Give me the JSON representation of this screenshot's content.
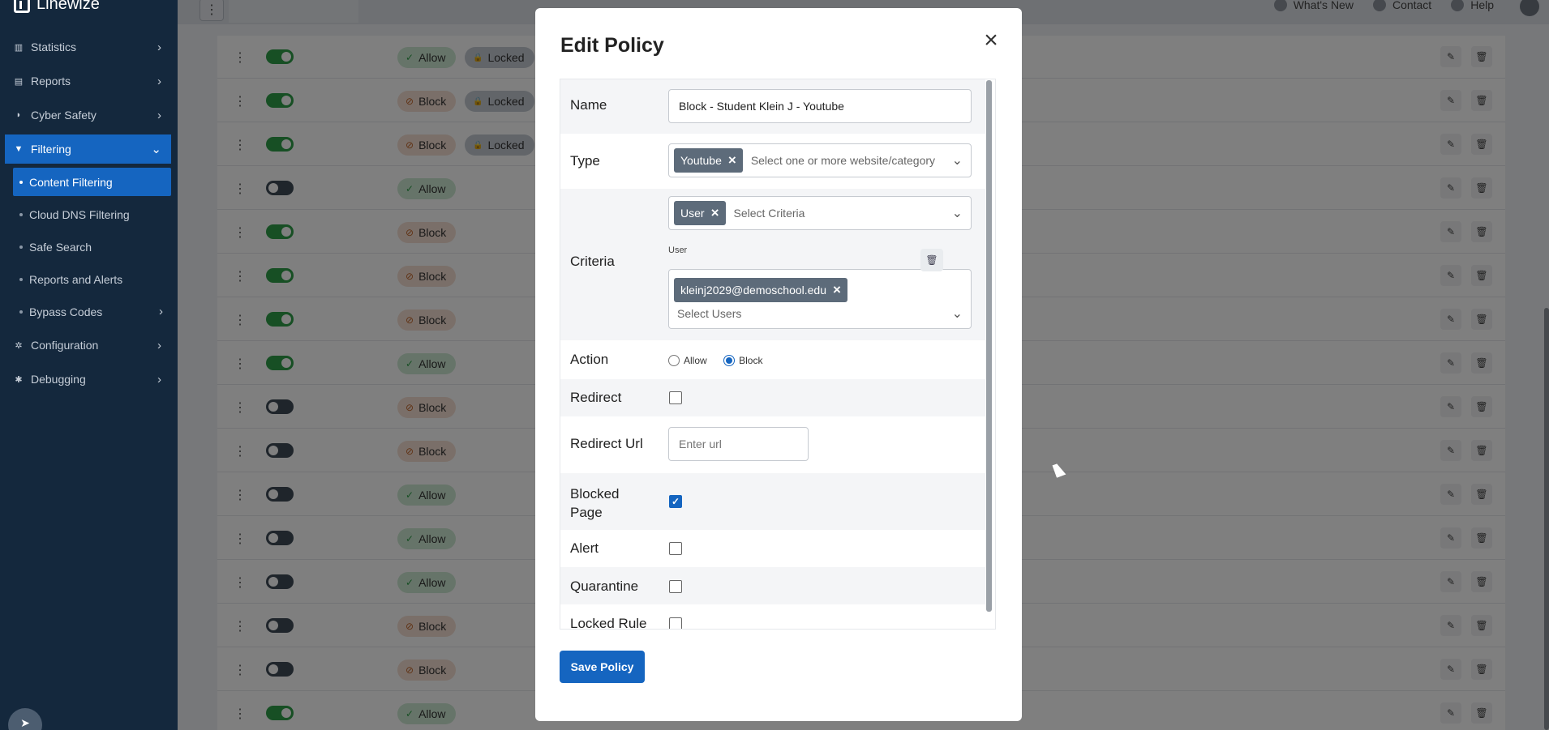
{
  "app": {
    "brand": "Linewize"
  },
  "topbar": {
    "links": [
      "What's New",
      "Contact",
      "Help"
    ]
  },
  "sidebar": {
    "items": [
      {
        "label": "Statistics",
        "icon": "chart-icon"
      },
      {
        "label": "Reports",
        "icon": "report-icon"
      },
      {
        "label": "Cyber Safety",
        "icon": "shield-icon"
      },
      {
        "label": "Filtering",
        "icon": "filter-icon",
        "active": true
      },
      {
        "label": "Configuration",
        "icon": "gear-icon"
      },
      {
        "label": "Debugging",
        "icon": "bug-icon"
      }
    ],
    "sub_items": [
      {
        "label": "Content Filtering",
        "active": true
      },
      {
        "label": "Cloud DNS Filtering"
      },
      {
        "label": "Safe Search"
      },
      {
        "label": "Reports and Alerts"
      },
      {
        "label": "Bypass Codes"
      }
    ]
  },
  "table": {
    "locked_label": "Locked",
    "rows": [
      {
        "enabled": true,
        "action": "Allow",
        "locked": true
      },
      {
        "enabled": true,
        "action": "Block",
        "locked": true
      },
      {
        "enabled": true,
        "action": "Block",
        "locked": true
      },
      {
        "enabled": false,
        "action": "Allow",
        "locked": false
      },
      {
        "enabled": true,
        "action": "Block",
        "locked": false
      },
      {
        "enabled": true,
        "action": "Block",
        "locked": false
      },
      {
        "enabled": true,
        "action": "Block",
        "locked": false
      },
      {
        "enabled": true,
        "action": "Allow",
        "locked": false
      },
      {
        "enabled": false,
        "action": "Block",
        "locked": false
      },
      {
        "enabled": false,
        "action": "Block",
        "locked": false
      },
      {
        "enabled": false,
        "action": "Allow",
        "locked": false
      },
      {
        "enabled": false,
        "action": "Allow",
        "locked": false
      },
      {
        "enabled": false,
        "action": "Allow",
        "locked": false
      },
      {
        "enabled": false,
        "action": "Block",
        "locked": false
      },
      {
        "enabled": false,
        "action": "Block",
        "locked": false
      },
      {
        "enabled": true,
        "action": "Allow",
        "locked": false
      }
    ]
  },
  "modal": {
    "title": "Edit Policy",
    "name_label": "Name",
    "name_value": "Block - Student Klein J - Youtube",
    "type_label": "Type",
    "type_chip": "Youtube",
    "type_placeholder": "Select one or more website/category",
    "criteria_label": "Criteria",
    "criteria_chip": "User",
    "criteria_placeholder": "Select Criteria",
    "criteria_sub_label": "User",
    "user_chip": "kleinj2029@demoschool.edu",
    "users_placeholder": "Select Users",
    "action_label": "Action",
    "action_options": [
      "Allow",
      "Block"
    ],
    "action_selected": "Block",
    "redirect_label": "Redirect",
    "redirect_checked": false,
    "redirect_url_label": "Redirect Url",
    "redirect_url_placeholder": "Enter url",
    "blocked_page_label_1": "Blocked",
    "blocked_page_label_2": "Page",
    "blocked_page_checked": true,
    "alert_label": "Alert",
    "alert_checked": false,
    "quarantine_label": "Quarantine",
    "quarantine_checked": false,
    "locked_rule_label": "Locked Rule",
    "locked_rule_checked": false,
    "save_label": "Save Policy"
  }
}
